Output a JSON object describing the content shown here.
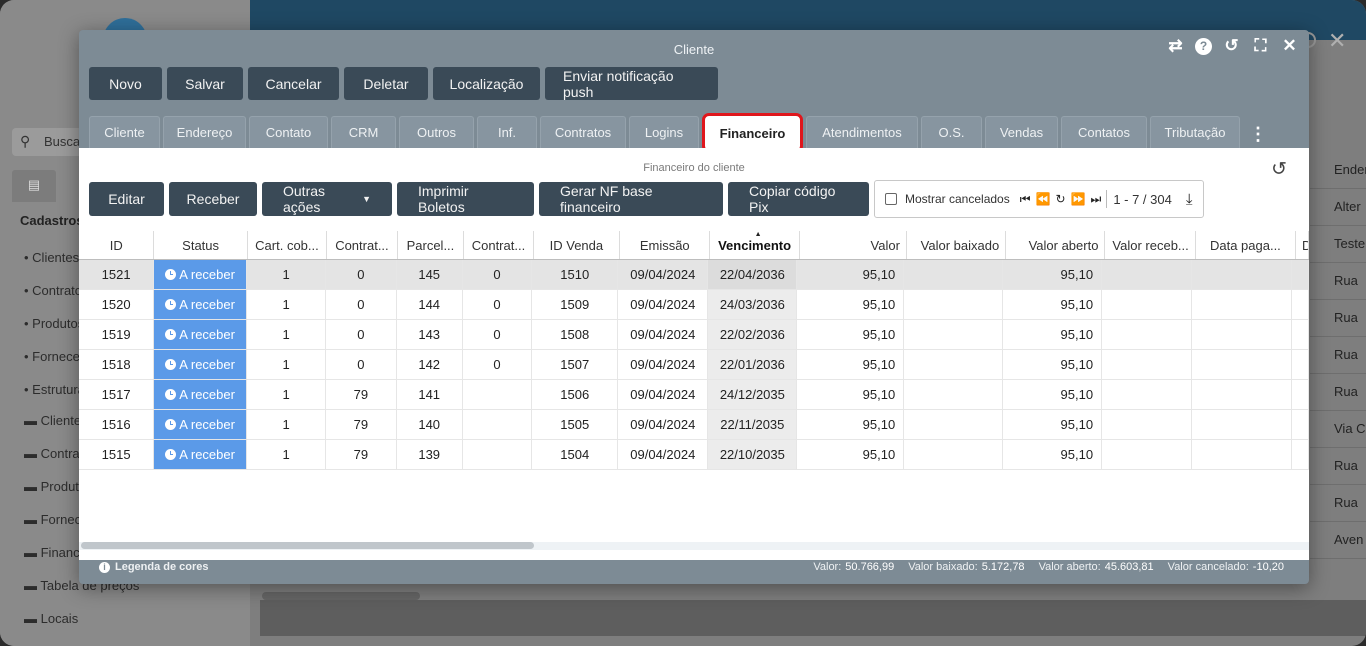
{
  "background": {
    "search_placeholder": "Buscar",
    "section_title": "Cadastros",
    "sidebar_items": [
      "Clientes",
      "Contratos",
      "Produtos",
      "Fornecedores",
      "Estruturas"
    ],
    "folders": [
      "Clientes",
      "Contratos",
      "Produtos",
      "Fornecedores",
      "Financeiro",
      "Tabela de preços",
      "Locais"
    ],
    "right_column_header": "Endereço",
    "right_column_cells": [
      "Alter",
      "Teste",
      "Rua",
      "Rua",
      "Rua",
      "Rua",
      "Via C",
      "Rua",
      "Rua",
      "Aven"
    ]
  },
  "modal": {
    "title": "Cliente",
    "header_icons": [
      "collapse-icon",
      "help-icon",
      "history-icon",
      "fullscreen-icon",
      "close-icon"
    ],
    "toolbar": [
      "Novo",
      "Salvar",
      "Cancelar",
      "Deletar",
      "Localização",
      "Enviar notificação push"
    ],
    "tabs": [
      "Cliente",
      "Endereço",
      "Contato",
      "CRM",
      "Outros",
      "Inf.",
      "Contratos",
      "Logins",
      "Financeiro",
      "Atendimentos",
      "O.S.",
      "Vendas",
      "Contatos",
      "Tributação"
    ],
    "active_tab": "Financeiro"
  },
  "panel": {
    "title": "Financeiro do cliente",
    "actions": [
      "Editar",
      "Receber",
      "Outras ações",
      "Imprimir Boletos",
      "Gerar NF base financeiro",
      "Copiar código Pix"
    ],
    "pager": {
      "show_canceled_label": "Mostrar cancelados",
      "range": "1 - 7 / 304"
    }
  },
  "grid": {
    "columns": [
      "ID",
      "Status",
      "Cart. cob...",
      "Contrat...",
      "Parcel...",
      "Contrat...",
      "ID Venda",
      "Emissão",
      "Vencimento",
      "Valor",
      "Valor baixado",
      "Valor aberto",
      "Valor receb...",
      "Data paga...",
      "D"
    ],
    "sorted_column": "Vencimento",
    "rows": [
      [
        "1521",
        "A receber",
        "1",
        "0",
        "145",
        "0",
        "1510",
        "09/04/2024",
        "22/04/2036",
        "95,10",
        "",
        "95,10",
        "",
        "",
        ""
      ],
      [
        "1520",
        "A receber",
        "1",
        "0",
        "144",
        "0",
        "1509",
        "09/04/2024",
        "24/03/2036",
        "95,10",
        "",
        "95,10",
        "",
        "",
        ""
      ],
      [
        "1519",
        "A receber",
        "1",
        "0",
        "143",
        "0",
        "1508",
        "09/04/2024",
        "22/02/2036",
        "95,10",
        "",
        "95,10",
        "",
        "",
        ""
      ],
      [
        "1518",
        "A receber",
        "1",
        "0",
        "142",
        "0",
        "1507",
        "09/04/2024",
        "22/01/2036",
        "95,10",
        "",
        "95,10",
        "",
        "",
        ""
      ],
      [
        "1517",
        "A receber",
        "1",
        "79",
        "141",
        "",
        "1506",
        "09/04/2024",
        "24/12/2035",
        "95,10",
        "",
        "95,10",
        "",
        "",
        ""
      ],
      [
        "1516",
        "A receber",
        "1",
        "79",
        "140",
        "",
        "1505",
        "09/04/2024",
        "22/11/2035",
        "95,10",
        "",
        "95,10",
        "",
        "",
        ""
      ],
      [
        "1515",
        "A receber",
        "1",
        "79",
        "139",
        "",
        "1504",
        "09/04/2024",
        "22/10/2035",
        "95,10",
        "",
        "95,10",
        "",
        "",
        ""
      ]
    ],
    "status_color": "#5b9ae8"
  },
  "footer": {
    "legend": "Legenda de cores",
    "totals": [
      {
        "label": "Valor:",
        "value": "50.766,99"
      },
      {
        "label": "Valor baixado:",
        "value": "5.172,78"
      },
      {
        "label": "Valor aberto:",
        "value": "45.603,81"
      },
      {
        "label": "Valor cancelado:",
        "value": "-10,20"
      }
    ]
  },
  "colors": {
    "accent_dark": "#3a4a57",
    "modal_bg": "#7d8b95",
    "active_tab_border": "#e0161c"
  }
}
